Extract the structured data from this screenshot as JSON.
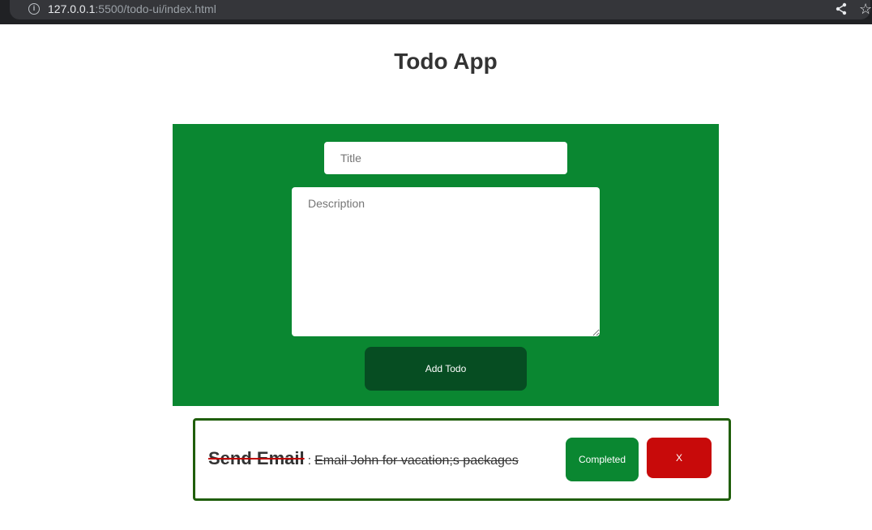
{
  "browser": {
    "url_host": "127.0.0.1",
    "url_path": ":5500/todo-ui/index.html",
    "icons": [
      "info-icon",
      "share-icon",
      "star-icon"
    ]
  },
  "header": {
    "title": "Todo App"
  },
  "form": {
    "title_placeholder": "Title",
    "title_value": "",
    "description_placeholder": "Description",
    "description_value": "",
    "add_button_label": "Add Todo",
    "panel_color": "#0a8731"
  },
  "todos": [
    {
      "title": "Send Email",
      "separator": " : ",
      "description": "Email John for vacation;s packages",
      "completed": true,
      "completed_label": "Completed",
      "delete_label": "X"
    }
  ],
  "colors": {
    "accent_green": "#0a8731",
    "dark_green": "#064d22",
    "delete_red": "#c80a0a",
    "card_border": "#1f5e0a"
  }
}
